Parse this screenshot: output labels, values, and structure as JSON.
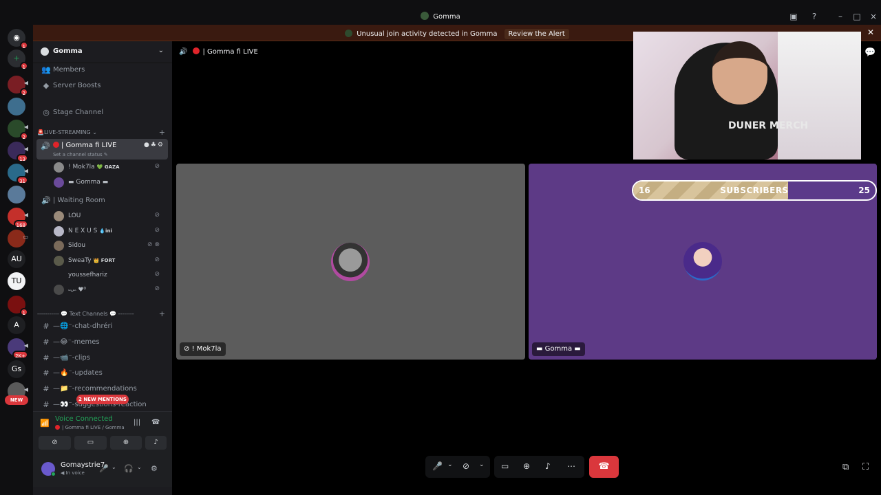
{
  "window": {
    "title": "Gomma"
  },
  "alert": {
    "text": "Unusual join activity detected in Gomma",
    "action": "Review the Alert"
  },
  "rail": {
    "servers": [
      {
        "id": "home",
        "badge": "1"
      },
      {
        "id": "add",
        "badge": "1"
      },
      {
        "id": "s3",
        "badge": "2"
      },
      {
        "id": "s4",
        "badge": ""
      },
      {
        "id": "s5",
        "badge": "2"
      },
      {
        "id": "s6",
        "badge": "13"
      },
      {
        "id": "s7",
        "badge": "31"
      },
      {
        "id": "s8",
        "badge": ""
      },
      {
        "id": "s9",
        "badge": "168"
      },
      {
        "id": "s10",
        "badge": ""
      },
      {
        "id": "s11",
        "label": "AU",
        "badge": ""
      },
      {
        "id": "s12",
        "badge": ""
      },
      {
        "id": "s13",
        "badge": "1"
      },
      {
        "id": "s14",
        "label": "A",
        "badge": ""
      },
      {
        "id": "s15",
        "badge": "2K+"
      },
      {
        "id": "s16",
        "label": "Gs",
        "badge": ""
      }
    ],
    "new_label": "NEW"
  },
  "sidebar": {
    "guild_name": "Gomma",
    "members": "Members",
    "boosts": "Server Boosts",
    "stage": "Stage Channel",
    "cat_live": "🚨LIVE-STREAMING",
    "active_channel": "| Gomma fi LIVE",
    "active_status": "Set a channel status",
    "voice_users": [
      {
        "name": "! Mok7la",
        "tag": "💚 GAZA"
      },
      {
        "name": "▬ Gomma ▬",
        "tag": ""
      }
    ],
    "waiting_room": "| Waiting Room",
    "waiting_users": [
      {
        "name": "LOU",
        "tag": ""
      },
      {
        "name": "N E X U S",
        "tag": "💧ini"
      },
      {
        "name": "Sidou",
        "tag": ""
      },
      {
        "name": "SweaTy",
        "tag": "👑 FORT"
      },
      {
        "name": "youssefhariz",
        "tag": ""
      },
      {
        "name": "˵ᴗ˵ ♥⁰",
        "tag": ""
      }
    ],
    "cat_text": "----------- 💬 Text Channels 💬 --------",
    "text_channels": [
      "—🌐⁻-chat-dhréri",
      "—😂⁻-memes",
      "—📹⁻-clips",
      "—🔥⁻-updates",
      "—📁⁻-recommendations",
      "—👀⁻-suggestions-reaction"
    ],
    "mentions": "2 NEW MENTIONS"
  },
  "voice": {
    "connected": "Voice Connected",
    "location": "| Gomma fi LIVE / Gomma"
  },
  "user": {
    "name": "Gomaystrie7",
    "status": "In voice"
  },
  "main": {
    "channel_title": "| Gomma fi LIVE",
    "tile_left_name": "! Mok7la",
    "tile_right_name": "▬ Gomma ▬",
    "webcam_text": "DUNER MERCH",
    "sub_goal": {
      "current": "16",
      "label": "SUBSCRIBERS",
      "target": "25",
      "progress": 0.64
    }
  },
  "colors": {
    "alert_bg": "#3a1a10",
    "accent_red": "#da373c",
    "voice_green": "#23a55a",
    "tile_left": "#5c5c5c",
    "tile_right": "#5d3a86"
  }
}
